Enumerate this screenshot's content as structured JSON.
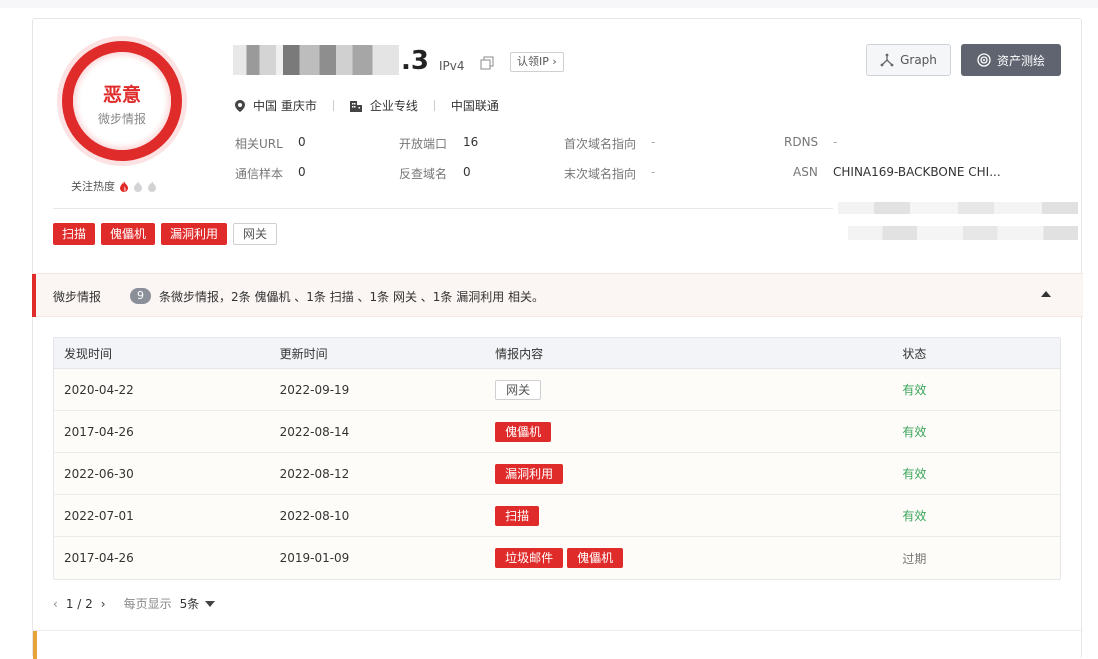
{
  "badge": {
    "verdict": "恶意",
    "source": "微步情报",
    "heat_label": "关注热度"
  },
  "ip": {
    "suffix": ".3",
    "version": "IPv4",
    "claim_label": "认领IP"
  },
  "location": {
    "country_city": "中国 重庆市",
    "line_type": "企业专线",
    "isp": "中国联通"
  },
  "meta": {
    "related_url_label": "相关URL",
    "related_url_value": "0",
    "open_ports_label": "开放端口",
    "open_ports_value": "16",
    "first_domain_label": "首次域名指向",
    "first_domain_value": "-",
    "rdns_label": "RDNS",
    "rdns_value": "-",
    "samples_label": "通信样本",
    "samples_value": "0",
    "reverse_domain_label": "反查域名",
    "reverse_domain_value": "0",
    "last_domain_label": "末次域名指向",
    "last_domain_value": "-",
    "asn_label": "ASN",
    "asn_value": "CHINA169-BACKBONE CHI..."
  },
  "tags": [
    {
      "label": "扫描",
      "style": "red"
    },
    {
      "label": "傀儡机",
      "style": "red"
    },
    {
      "label": "漏洞利用",
      "style": "red"
    },
    {
      "label": "网关",
      "style": "gray"
    }
  ],
  "buttons": {
    "graph": "Graph",
    "asset": "资产测绘"
  },
  "intel": {
    "title": "微步情报",
    "count": "9",
    "summary": "条微步情报，2条 傀儡机 、1条 扫描 、1条 网关 、1条 漏洞利用 相关。"
  },
  "table": {
    "headers": [
      "发现时间",
      "更新时间",
      "情报内容",
      "状态"
    ],
    "rows": [
      {
        "found": "2020-04-22",
        "updated": "2022-09-19",
        "tags": [
          {
            "label": "网关",
            "style": "gray"
          }
        ],
        "status": "有效",
        "status_type": "valid"
      },
      {
        "found": "2017-04-26",
        "updated": "2022-08-14",
        "tags": [
          {
            "label": "傀儡机",
            "style": "red"
          }
        ],
        "status": "有效",
        "status_type": "valid"
      },
      {
        "found": "2022-06-30",
        "updated": "2022-08-12",
        "tags": [
          {
            "label": "漏洞利用",
            "style": "red"
          }
        ],
        "status": "有效",
        "status_type": "valid"
      },
      {
        "found": "2022-07-01",
        "updated": "2022-08-10",
        "tags": [
          {
            "label": "扫描",
            "style": "red"
          }
        ],
        "status": "有效",
        "status_type": "valid"
      },
      {
        "found": "2017-04-26",
        "updated": "2019-01-09",
        "tags": [
          {
            "label": "垃圾邮件",
            "style": "red"
          },
          {
            "label": "傀儡机",
            "style": "red"
          }
        ],
        "status": "过期",
        "status_type": "expired"
      }
    ]
  },
  "pager": {
    "page": "1 / 2",
    "per_page_label": "每页显示",
    "per_page_value": "5条"
  },
  "colors": {
    "accent_red": "#e02b2b",
    "valid_green": "#3aa55b",
    "button_dark": "#5f6470"
  }
}
